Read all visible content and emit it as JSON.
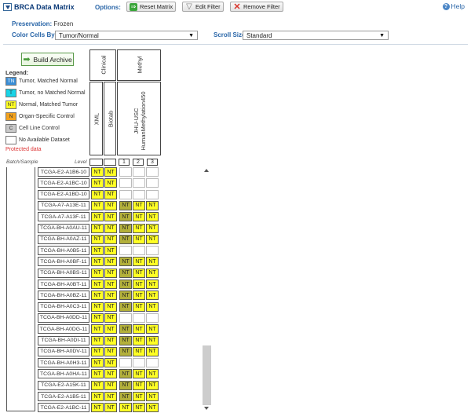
{
  "header": {
    "title": "BRCA Data Matrix",
    "options_label": "Options:",
    "buttons": [
      {
        "label": "Reset Matrix",
        "icon": "reset-icon",
        "color": "#3aa53a"
      },
      {
        "label": "Edit Filter",
        "icon": "filter-icon",
        "color": "#888888"
      },
      {
        "label": "Remove Filter",
        "icon": "remove-icon",
        "color": "#d9342b"
      }
    ],
    "help": "Help"
  },
  "preservation": {
    "label": "Preservation:",
    "value": "Frozen"
  },
  "color_cells_by": {
    "label": "Color Cells By:",
    "value": "Tumor/Normal"
  },
  "scroll_size": {
    "label": "Scroll Size:",
    "value": "Standard"
  },
  "build_archive": "Build Archive",
  "legend": {
    "title": "Legend:",
    "items": [
      {
        "code": "TN",
        "label": "Tumor, Matched Normal",
        "color": "#3a8ed6"
      },
      {
        "code": "T",
        "label": "Tumor, no Matched Normal",
        "color": "#19d3e6"
      },
      {
        "code": "NT",
        "label": "Normal, Matched Tumor",
        "color": "#ffff24"
      },
      {
        "code": "N",
        "label": "Organ-Specific Control",
        "color": "#f3a21d"
      },
      {
        "code": "C",
        "label": "Cell Line Control",
        "color": "#c8c8c8"
      },
      {
        "code": "",
        "label": "No Available Dataset",
        "color": "#ffffff"
      }
    ],
    "protected": "*Protected data"
  },
  "batch_label": "Batch/Sample",
  "level_label": "Level",
  "columns": {
    "clinical": "Clinical",
    "methyl": "Methyl",
    "xml": "XML",
    "biotab": "Biotab",
    "methyl_platform": "JHU-USC HumanMethylation450",
    "levels": [
      "1",
      "2",
      "3"
    ]
  },
  "rows": [
    {
      "sample": "TCGA-E2-A1B6-10",
      "cells": [
        "NT",
        "NT",
        "",
        "",
        ""
      ]
    },
    {
      "sample": "TCGA-E2-A1BC-10",
      "cells": [
        "NT",
        "NT",
        "",
        "",
        ""
      ]
    },
    {
      "sample": "TCGA-E2-A1BD-10",
      "cells": [
        "NT",
        "NT",
        "",
        "",
        ""
      ]
    },
    {
      "sample": "TCGA-A7-A13E-11",
      "cells": [
        "NT",
        "NT",
        "NT*",
        "NT",
        "NT"
      ]
    },
    {
      "sample": "TCGA-A7-A13F-11",
      "cells": [
        "NT",
        "NT",
        "NT*",
        "NT",
        "NT"
      ]
    },
    {
      "sample": "TCGA-BH-A0AU-11",
      "cells": [
        "NT",
        "NT",
        "NT*",
        "NT",
        "NT"
      ]
    },
    {
      "sample": "TCGA-BH-A0AZ-11",
      "cells": [
        "NT",
        "NT",
        "NT*",
        "NT",
        "NT"
      ]
    },
    {
      "sample": "TCGA-BH-A0B5-11",
      "cells": [
        "NT",
        "NT",
        "",
        "",
        ""
      ]
    },
    {
      "sample": "TCGA-BH-A0BF-11",
      "cells": [
        "NT",
        "NT",
        "NT*",
        "NT",
        "NT"
      ]
    },
    {
      "sample": "TCGA-BH-A0BS-11",
      "cells": [
        "NT",
        "NT",
        "NT*",
        "NT",
        "NT"
      ]
    },
    {
      "sample": "TCGA-BH-A0BT-11",
      "cells": [
        "NT",
        "NT",
        "NT*",
        "NT",
        "NT"
      ]
    },
    {
      "sample": "TCGA-BH-A0BZ-11",
      "cells": [
        "NT",
        "NT",
        "NT*",
        "NT",
        "NT"
      ]
    },
    {
      "sample": "TCGA-BH-A0C3-11",
      "cells": [
        "NT",
        "NT",
        "NT*",
        "NT",
        "NT"
      ]
    },
    {
      "sample": "TCGA-BH-A0DD-11",
      "cells": [
        "NT",
        "NT",
        "",
        "",
        ""
      ]
    },
    {
      "sample": "TCGA-BH-A0DG-11",
      "cells": [
        "NT",
        "NT",
        "NT*",
        "NT",
        "NT"
      ]
    },
    {
      "sample": "TCGA-BH-A0DI-11",
      "cells": [
        "NT",
        "NT",
        "NT*",
        "NT",
        "NT"
      ]
    },
    {
      "sample": "TCGA-BH-A0DV-11",
      "cells": [
        "NT",
        "NT",
        "NT*",
        "NT",
        "NT"
      ]
    },
    {
      "sample": "TCGA-BH-A0H3-11",
      "cells": [
        "NT",
        "NT",
        "",
        "",
        ""
      ]
    },
    {
      "sample": "TCGA-BH-A0HA-11",
      "cells": [
        "NT",
        "NT",
        "NT*",
        "NT",
        "NT"
      ]
    },
    {
      "sample": "TCGA-E2-A15K-11",
      "cells": [
        "NT",
        "NT",
        "NT*",
        "NT",
        "NT"
      ]
    },
    {
      "sample": "TCGA-E2-A1B5-11",
      "cells": [
        "NT",
        "NT",
        "NT*",
        "NT",
        "NT"
      ]
    },
    {
      "sample": "TCGA-E2-A1BC-11",
      "cells": [
        "NT",
        "NT",
        "NT",
        "NT",
        "NT"
      ]
    }
  ]
}
